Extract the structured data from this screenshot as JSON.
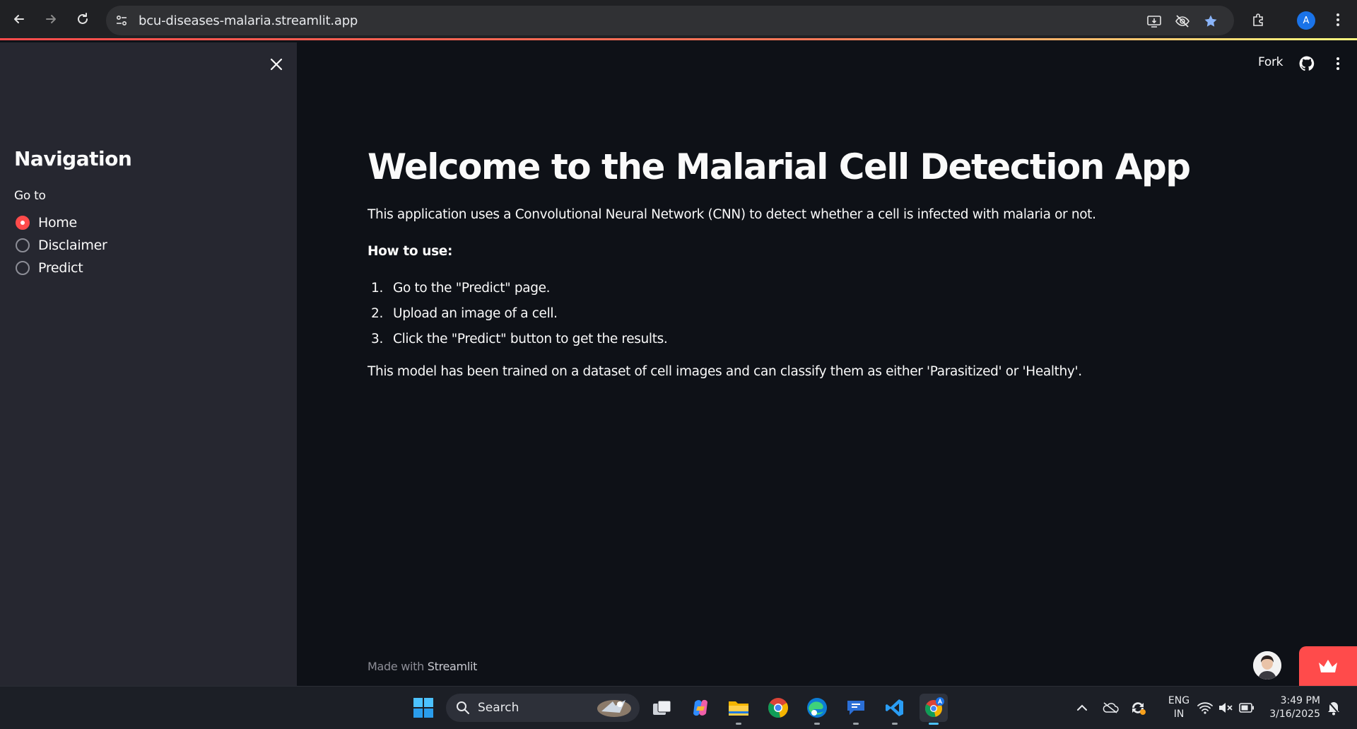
{
  "browser": {
    "url": "bcu-diseases-malaria.streamlit.app",
    "profile_initial": "A"
  },
  "sidebar": {
    "title": "Navigation",
    "radio_label": "Go to",
    "options": [
      {
        "label": "Home",
        "selected": true
      },
      {
        "label": "Disclaimer",
        "selected": false
      },
      {
        "label": "Predict",
        "selected": false
      }
    ]
  },
  "header": {
    "fork_label": "Fork"
  },
  "main": {
    "title": "Welcome to the Malarial Cell Detection App",
    "intro": "This application uses a Convolutional Neural Network (CNN) to detect whether a cell is infected with malaria or not.",
    "howto_heading": "How to use:",
    "steps": [
      {
        "num": "1.",
        "text": "Go to the \"Predict\" page."
      },
      {
        "num": "2.",
        "text": "Upload an image of a cell."
      },
      {
        "num": "3.",
        "text": "Click the \"Predict\" button to get the results."
      }
    ],
    "summary": "This model has been trained on a dataset of cell images and can classify them as either 'Parasitized' or 'Healthy'."
  },
  "footer": {
    "prefix": "Made with ",
    "brand": "Streamlit"
  },
  "taskbar": {
    "search_label": "Search",
    "lang_line1": "ENG",
    "lang_line2": "IN",
    "time": "3:49 PM",
    "date": "3/16/2025"
  },
  "colors": {
    "accent": "#ff4b4b",
    "sidebar_bg": "#262730",
    "main_bg": "#0e1117"
  }
}
